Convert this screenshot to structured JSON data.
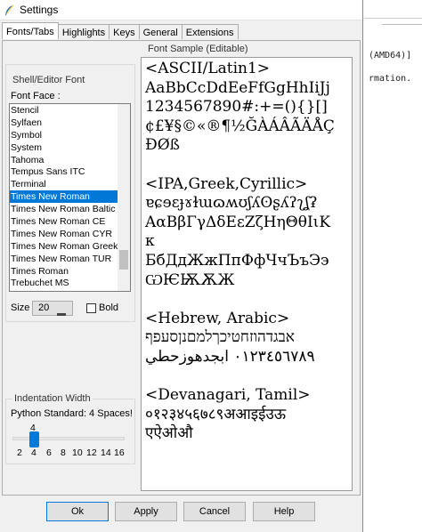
{
  "window": {
    "title": "Settings"
  },
  "tabs": [
    "Fonts/Tabs",
    "Highlights",
    "Keys",
    "General",
    "Extensions"
  ],
  "shell_font": {
    "group_label": "Shell/Editor Font",
    "font_face_label": "Font Face :",
    "fonts": [
      "Stencil",
      "Sylfaen",
      "Symbol",
      "System",
      "Tahoma",
      "Tempus Sans ITC",
      "Terminal",
      "Times New Roman",
      "Times New Roman Baltic",
      "Times New Roman CE",
      "Times New Roman CYR",
      "Times New Roman Greek",
      "Times New Roman TUR",
      "Times Roman",
      "Trebuchet MS"
    ],
    "selected_font": "Times New Roman",
    "size_label": "Size :",
    "size_value": "20",
    "bold_label": "Bold"
  },
  "indentation": {
    "group_label": "Indentation Width",
    "standard_text": "Python Standard: 4 Spaces!",
    "value": "4",
    "ticks": [
      "2",
      "4",
      "6",
      "8",
      "10",
      "12",
      "14",
      "16"
    ]
  },
  "font_sample": {
    "label": "Font Sample (Editable)",
    "text": "<ASCII/Latin1>\nAaBbCcDdEeFfGgHhIiJj\n1234567890#:+=(){}[]\n¢£¥§©«®¶½ĞÀÁÂÃÄÅÇ\nÐØß\n\n<IPA,Greek,Cyrillic>\nɐɕɘɛɟɤɫɯɷʍʊʃʎʘʂʎʔʅʆʡ\nΑαΒβΓγΔδΕεΖζΗηΘθΙιΚ\nκ\nБбДдЖжПпФфЧчЪъЭэ\nѠѤѬѪЖ\n\n<Hebrew, Arabic>\nאבגדהוזחטיכךלמםנןסעפף\n٠١٢٣٤٥٦٧٨٩ ابجدهوزحطي\n\n<Devanagari, Tamil>\n०१२३४५६७८९अआइईउऊ\nएऐओऔ"
  },
  "buttons": {
    "ok": "Ok",
    "apply": "Apply",
    "cancel": "Cancel",
    "help": "Help"
  },
  "background_window": {
    "line1": "(AMD64)]",
    "line2": "rmation."
  },
  "colors": {
    "selection": "#0078d7",
    "dialog_bg": "#f0f0f0",
    "slider": "#007ad9"
  }
}
